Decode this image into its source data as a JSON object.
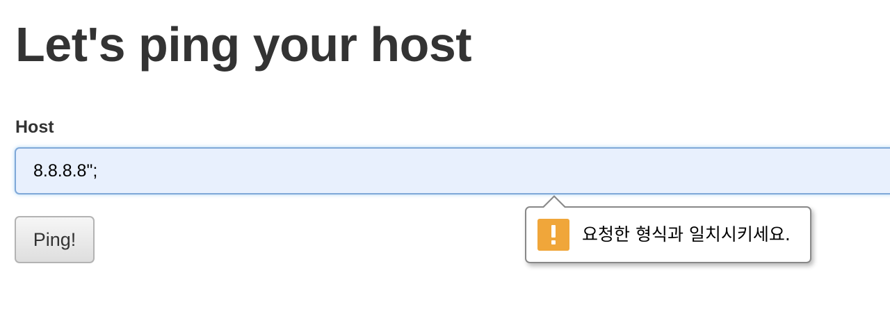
{
  "page": {
    "title": "Let's ping your host"
  },
  "form": {
    "host_label": "Host",
    "host_value": "8.8.8.8\";",
    "submit_label": "Ping!"
  },
  "validation_tooltip": {
    "icon": "warning-exclamation-icon",
    "icon_color": "#f0a63a",
    "message": "요청한 형식과 일치시키세요."
  },
  "colors": {
    "input_background": "#e8f0fd",
    "input_border": "#7fa8d8",
    "text": "#333333"
  }
}
